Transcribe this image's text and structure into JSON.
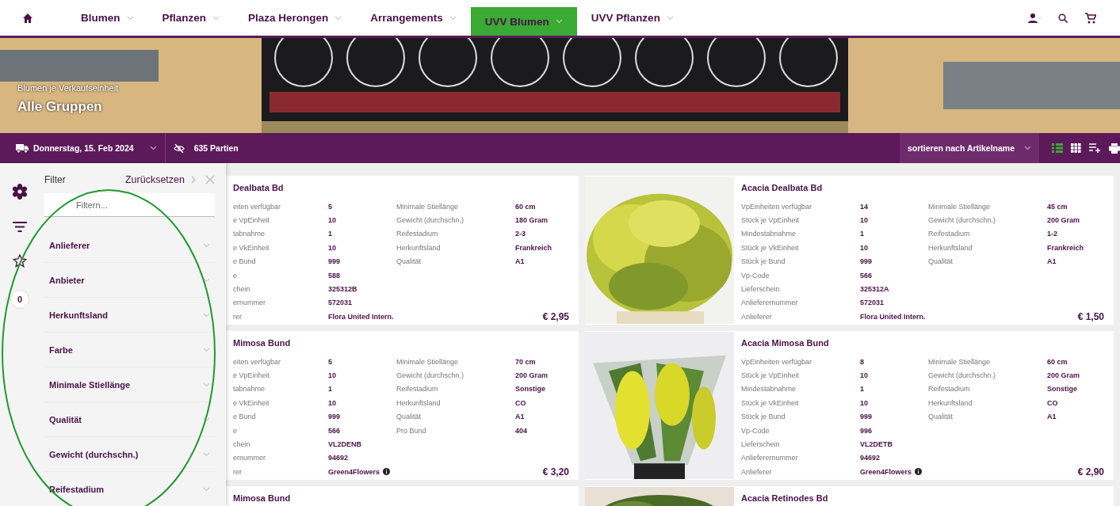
{
  "nav": {
    "items": [
      {
        "label": "Blumen",
        "selected": false
      },
      {
        "label": "Pflanzen",
        "selected": false
      },
      {
        "label": "Plaza Herongen",
        "selected": false
      },
      {
        "label": "Arrangements",
        "selected": false
      },
      {
        "label": "UVV Blumen",
        "selected": true
      },
      {
        "label": "UVV Pflanzen",
        "selected": false
      }
    ]
  },
  "banner": {
    "kind": "picture",
    "subtitle": "Blumen je Verkaufseinheit",
    "title": "Alle Gruppen"
  },
  "toolbar": {
    "date": "Donnerstag, 15. Feb 2024",
    "lots": "635 Partien",
    "sort": "sortieren nach Artikelname",
    "view_modes": [
      {
        "kind": "list",
        "selected": true
      },
      {
        "kind": "grid",
        "selected": false
      },
      {
        "kind": "add-list",
        "selected": false
      },
      {
        "kind": "print",
        "selected": false
      }
    ]
  },
  "side_icons": [
    {
      "kind": "flower"
    },
    {
      "kind": "filter"
    },
    {
      "kind": "star"
    },
    {
      "kind": "count",
      "text": "0"
    }
  ],
  "filter_panel": {
    "title": "Filter",
    "reset": "Zurücksetzen",
    "search": {
      "placeholder": "Filtern..."
    },
    "sections": [
      {
        "label": "Anlieferer"
      },
      {
        "label": "Anbieter"
      },
      {
        "label": "Herkunftsland"
      },
      {
        "label": "Farbe"
      },
      {
        "label": "Minimale Stiellänge"
      },
      {
        "label": "Qualität"
      },
      {
        "label": "Gewicht (durchschn.)"
      },
      {
        "label": "Reifestadium"
      }
    ]
  },
  "annotations": [
    {
      "kind": "ellipse",
      "color": "#1e9a2e"
    }
  ],
  "left_cards": [
    {
      "title": "Dealbata Bd",
      "price": "€ 2,95",
      "rows": [
        {
          "label": "eiten verfügbar",
          "value": "5",
          "label_2": "Minimale Stiellänge",
          "value_2": "60 cm"
        },
        {
          "label": "e VpEinheit",
          "value": "10",
          "label_2": "Gewicht (durchschn.)",
          "value_2": "180 Gram"
        },
        {
          "label": "tabnahme",
          "value": "1",
          "label_2": "Reifestadium",
          "value_2": "2-3"
        },
        {
          "label": "e VkEinheit",
          "value": "10",
          "label_2": "Herkunftsland",
          "value_2": "Frankreich"
        },
        {
          "label": "e Bund",
          "value": "999",
          "label_2": "Qualität",
          "value_2": "A1"
        },
        {
          "label": "e",
          "value": "588"
        },
        {
          "label": "chein",
          "value": "325312B"
        },
        {
          "label": "ernummer",
          "value": "572031"
        },
        {
          "label": "rer",
          "value": "Flora United Intern."
        }
      ]
    },
    {
      "title": "Mimosa Bund",
      "price": "€ 3,20",
      "rows": [
        {
          "label": "eiten verfügbar",
          "value": "5",
          "label_2": "Minimale Stiellänge",
          "value_2": "70 cm"
        },
        {
          "label": "e VpEinheit",
          "value": "10",
          "label_2": "Gewicht (durchschn.)",
          "value_2": "200 Gram"
        },
        {
          "label": "tabnahme",
          "value": "1",
          "label_2": "Reifestadium",
          "value_2": "Sonstige"
        },
        {
          "label": "e VkEinheit",
          "value": "10",
          "label_2": "Herkunftsland",
          "value_2": "CO"
        },
        {
          "label": "e Bund",
          "value": "999",
          "label_2": "Qualität",
          "value_2": "A1"
        },
        {
          "label": "e",
          "value": "566",
          "label_2": "Pro Bund",
          "value_2": "404"
        },
        {
          "label": "chein",
          "value": "VL2DENB"
        },
        {
          "label": "ernummer",
          "value": "94692"
        },
        {
          "label": "rer",
          "value": "Green4Flowers",
          "info": true
        }
      ]
    },
    {
      "title": "Mimosa Bund"
    }
  ],
  "right_cards": [
    {
      "title": "Acacia Dealbata Bd",
      "price": "€ 1,50",
      "rows": [
        {
          "label": "VpEinheiten verfügbar",
          "value": "14",
          "label_2": "Minimale Stiellänge",
          "value_2": "45 cm"
        },
        {
          "label": "Stück je VpEinheit",
          "value": "10",
          "label_2": "Gewicht (durchschn.)",
          "value_2": "200 Gram"
        },
        {
          "label": "Mindestabnahme",
          "value": "1",
          "label_2": "Reifestadium",
          "value_2": "1-2"
        },
        {
          "label": "Stück je VkEinheit",
          "value": "10",
          "label_2": "Herkunftsland",
          "value_2": "Frankreich"
        },
        {
          "label": "Stück je Bund",
          "value": "999",
          "label_2": "Qualität",
          "value_2": "A1"
        },
        {
          "label": "Vp-Code",
          "value": "566"
        },
        {
          "label": "Lieferschein",
          "value": "325312A"
        },
        {
          "label": "Anlieferernummer",
          "value": "572031"
        },
        {
          "label": "Anlieferer",
          "value": "Flora United Intern."
        }
      ]
    },
    {
      "title": "Acacia Mimosa Bund",
      "price": "€ 2,90",
      "rows": [
        {
          "label": "VpEinheiten verfügbar",
          "value": "8",
          "label_2": "Minimale Stiellänge",
          "value_2": "60 cm"
        },
        {
          "label": "Stück je VpEinheit",
          "value": "10",
          "label_2": "Gewicht (durchschn.)",
          "value_2": "200 Gram"
        },
        {
          "label": "Mindestabnahme",
          "value": "1",
          "label_2": "Reifestadium",
          "value_2": "Sonstige"
        },
        {
          "label": "Stück je VkEinheit",
          "value": "10",
          "label_2": "Herkunftsland",
          "value_2": "CO"
        },
        {
          "label": "Stück je Bund",
          "value": "999",
          "label_2": "Qualität",
          "value_2": "A1"
        },
        {
          "label": "Vp-Code",
          "value": "996"
        },
        {
          "label": "Lieferschein",
          "value": "VL2DETB"
        },
        {
          "label": "Anlieferernummer",
          "value": "94692"
        },
        {
          "label": "Anlieferer",
          "value": "Green4Flowers",
          "info": true
        }
      ]
    },
    {
      "title": "Acacia Retinodes Bd"
    }
  ]
}
